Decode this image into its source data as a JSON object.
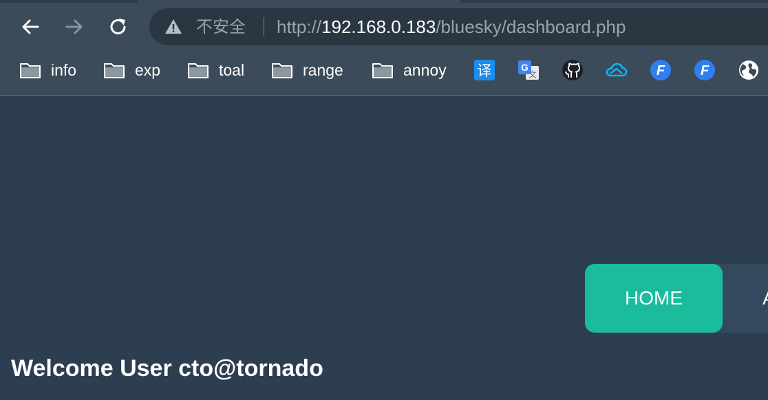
{
  "browser": {
    "address_bar": {
      "security_label": "不安全",
      "url_scheme": "http://",
      "url_host": "192.168.0.183",
      "url_path": "/bluesky/dashboard.php"
    },
    "nav_icons": [
      "back-arrow-icon",
      "forward-arrow-icon",
      "reload-icon"
    ],
    "bookmarks": [
      {
        "label": "info",
        "icon": "folder-icon"
      },
      {
        "label": "exp",
        "icon": "folder-icon"
      },
      {
        "label": "toal",
        "icon": "folder-icon"
      },
      {
        "label": "range",
        "icon": "folder-icon"
      },
      {
        "label": "annoy",
        "icon": "folder-icon"
      }
    ],
    "extension_icons": {
      "translate_zh": "译",
      "google_translate": "G",
      "github": "github-icon",
      "cloud": "cloud-icon",
      "fofa_1": "F",
      "fofa_2": "F",
      "globe": "globe-icon"
    }
  },
  "page": {
    "nav": {
      "home_label": "HOME",
      "next_label": "A"
    },
    "welcome_text": "Welcome User cto@tornado"
  },
  "colors": {
    "page_background": "#2c3e50",
    "chrome_background": "#3c4b59",
    "accent_home": "#1abc9c",
    "menu_background": "#34495e"
  }
}
